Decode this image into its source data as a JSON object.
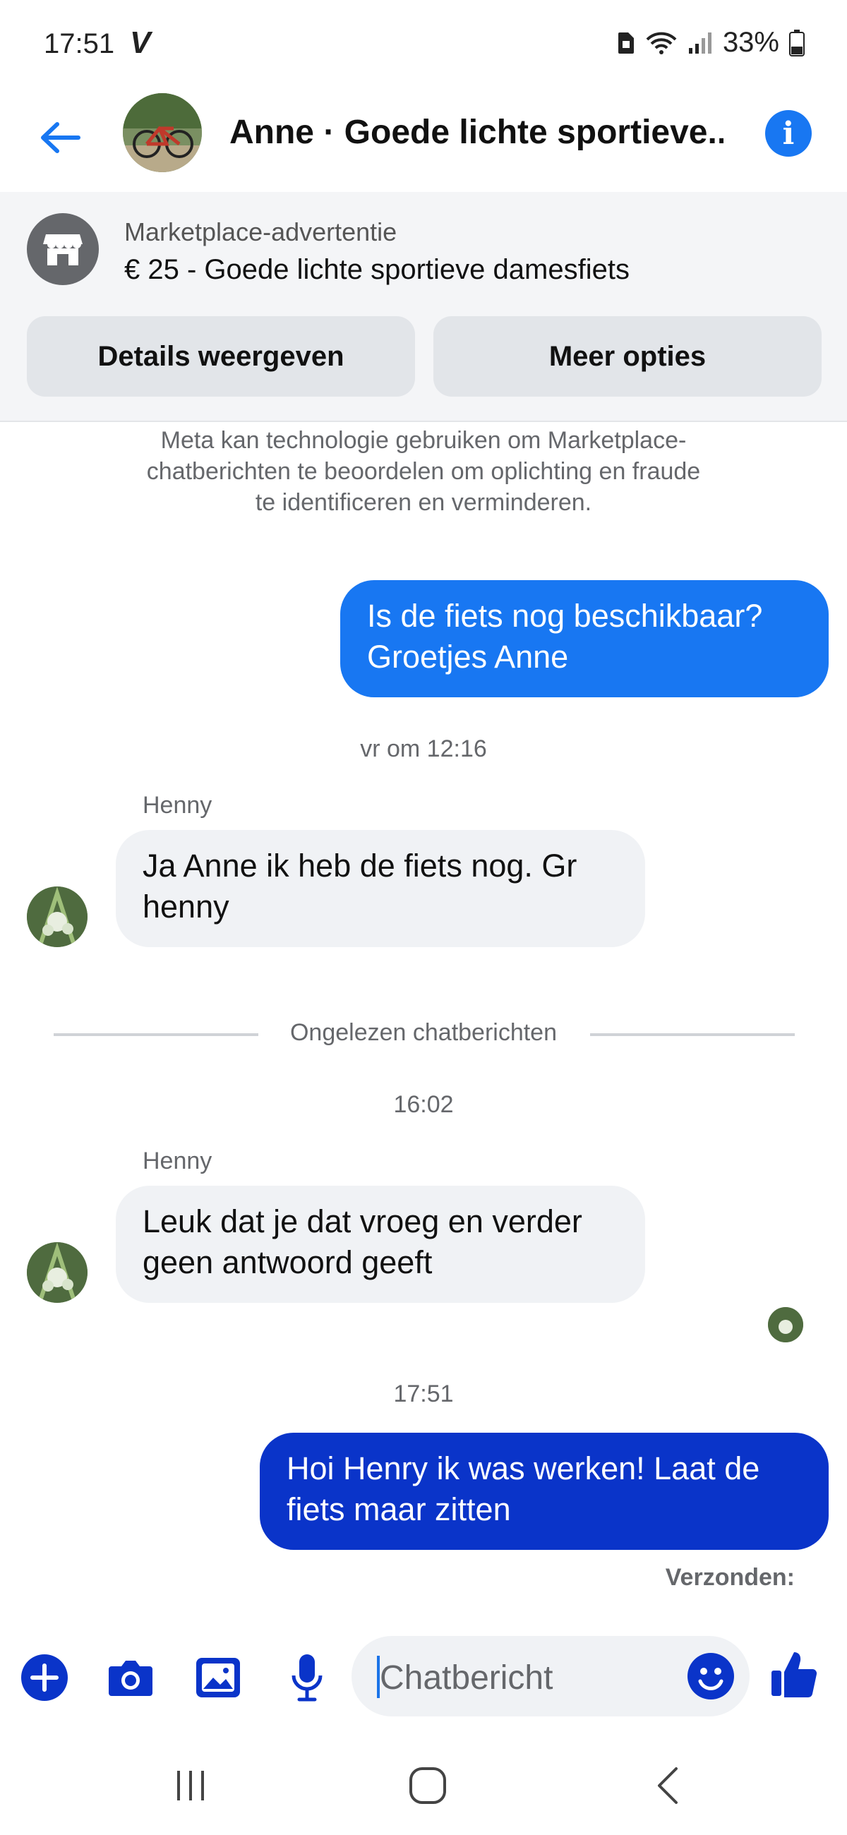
{
  "status_bar": {
    "time": "17:51",
    "carrier_icon": "V",
    "battery": "33%"
  },
  "header": {
    "title": "Anne · Goede lichte sportieve...",
    "info_icon": "i"
  },
  "marketplace": {
    "label": "Marketplace-advertentie",
    "listing": "€ 25 - Goede lichte sportieve damesfiets",
    "details_button": "Details weergeven",
    "more_button": "Meer opties"
  },
  "chat": {
    "notice": "Meta kan technologie gebruiken om Marketplace-chatberichten te beoordelen om oplichting en fraude te identificeren en verminderen.",
    "msg1_line1": "Is de fiets nog beschikbaar?",
    "msg1_line2": "Groetjes Anne",
    "time1": "vr om 12:16",
    "sender1": "Henny",
    "msg2_line1": "Ja Anne ik heb de fiets nog. Gr",
    "msg2_line2": "henny",
    "unread_divider": "Ongelezen chatberichten",
    "time2": "16:02",
    "sender2": "Henny",
    "msg3_line1": "Leuk dat je dat vroeg en verder",
    "msg3_line2": "geen antwoord geeft",
    "time3": "17:51",
    "msg4_line1": "Hoi Henry ik was werken! Laat de",
    "msg4_line2": "fiets maar zitten",
    "sent_status": "Verzonden:"
  },
  "composer": {
    "placeholder": "Chatbericht"
  },
  "colors": {
    "messenger_blue": "#1877f2",
    "dark_blue": "#0a34c9",
    "bubble_gray": "#f0f2f5"
  }
}
